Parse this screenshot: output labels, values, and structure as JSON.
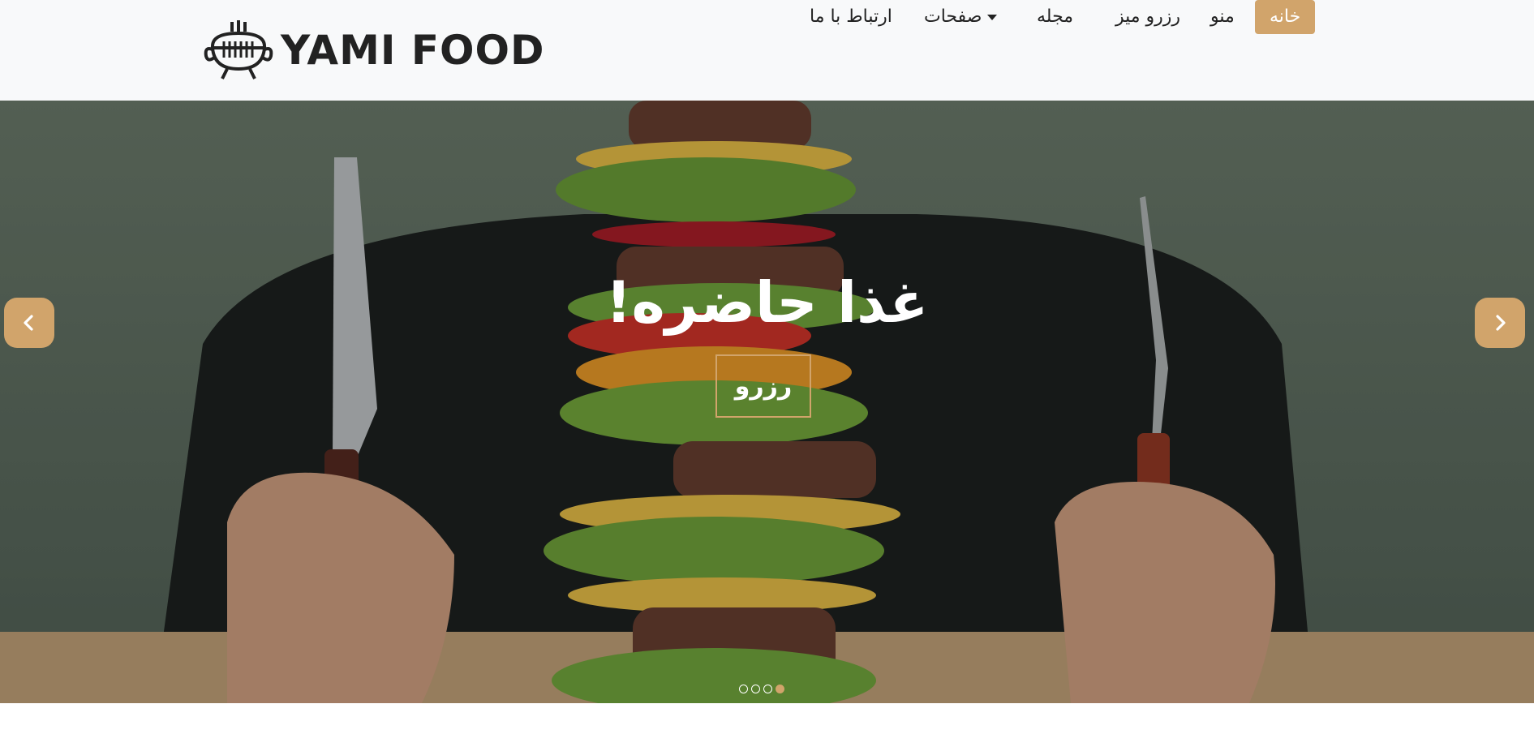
{
  "brand": {
    "name": "YAMI FOOD",
    "logo_icon": "grill-pot-icon"
  },
  "nav": {
    "home": "خانه",
    "menu": "منو",
    "reserve_table": "رزرو میز",
    "magazine": "مجله",
    "pages": "صفحات",
    "contact": "ارتباط با ما"
  },
  "hero": {
    "title": "غذا حاضره!",
    "button": "رزرو",
    "prev_icon": "chevron-left-icon",
    "next_icon": "chevron-right-icon",
    "slides_count": 4,
    "active_slide": 4
  },
  "colors": {
    "accent": "#d1a46b",
    "navbar_bg": "#f8f9fa"
  }
}
